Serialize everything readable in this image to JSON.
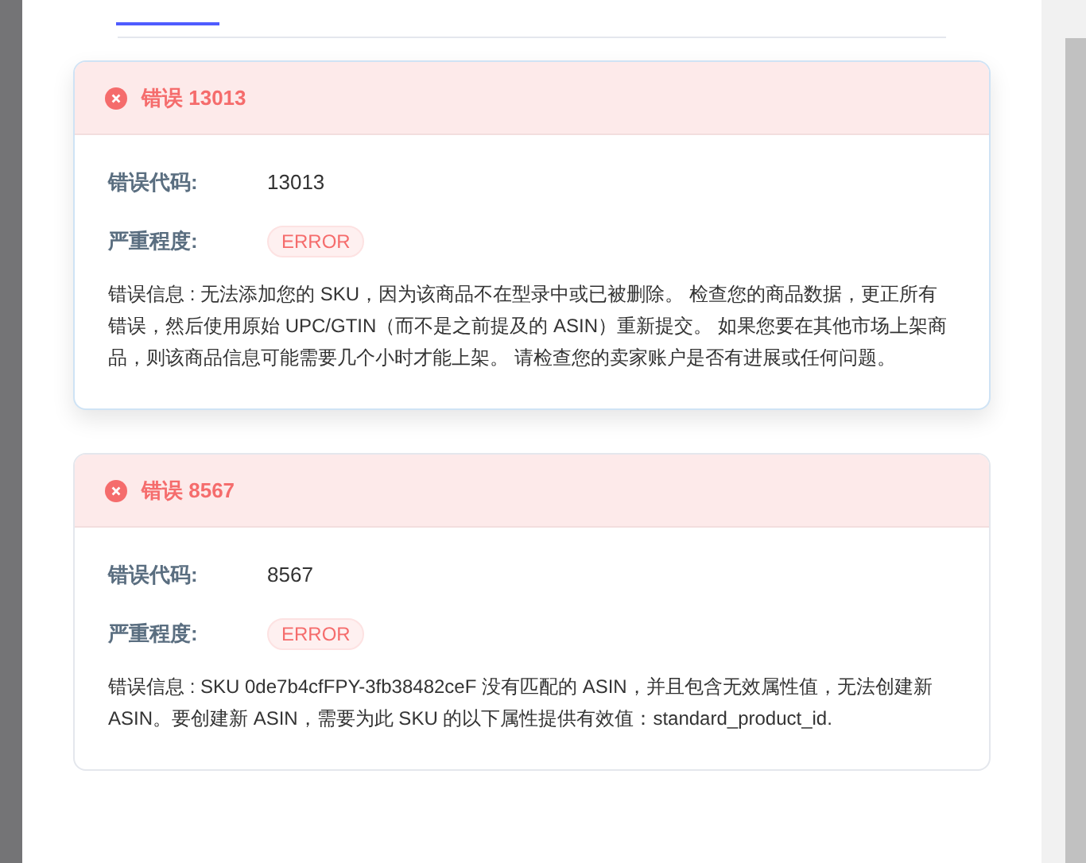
{
  "errors": [
    {
      "title": "错误 13013",
      "highlighted": true,
      "fields": [
        {
          "kind": "text",
          "label": "错误代码:",
          "value": "13013"
        },
        {
          "kind": "badge",
          "label": "严重程度:",
          "value": "ERROR"
        }
      ],
      "message": "错误信息 : 无法添加您的 SKU，因为该商品不在型录中或已被删除。 检查您的商品数据，更正所有错误，然后使用原始 UPC/GTIN（而不是之前提及的 ASIN）重新提交。 如果您要在其他市场上架商品，则该商品信息可能需要几个小时才能上架。 请检查您的卖家账户是否有进展或任何问题。"
    },
    {
      "title": "错误 8567",
      "highlighted": false,
      "fields": [
        {
          "kind": "text",
          "label": "错误代码:",
          "value": "8567"
        },
        {
          "kind": "badge",
          "label": "严重程度:",
          "value": "ERROR"
        }
      ],
      "message": "错误信息 : SKU 0de7b4cfFPY-3fb38482ceF 没有匹配的 ASIN，并且包含无效属性值，无法创建新 ASIN。要创建新 ASIN，需要为此 SKU 的以下属性提供有效值：standard_product_id."
    }
  ]
}
